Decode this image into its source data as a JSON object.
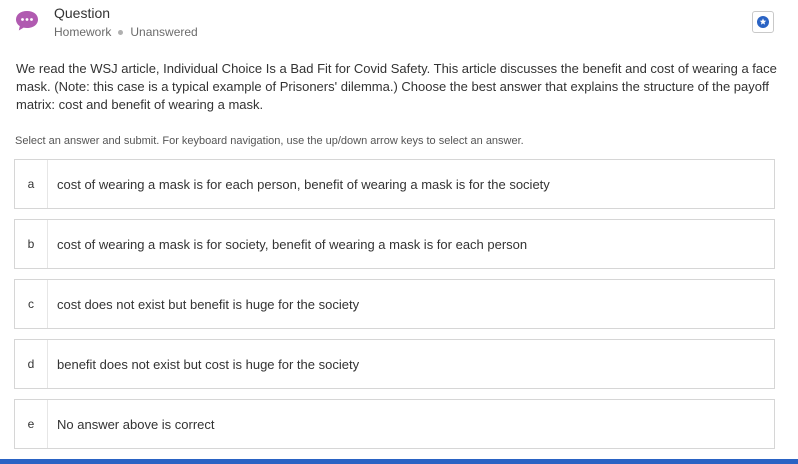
{
  "header": {
    "title": "Question",
    "category": "Homework",
    "status": "Unanswered",
    "icon": "chat-bubble-ellipsis-icon",
    "icon_color": "#b05ab0",
    "bookmark_icon": "star-badge-icon",
    "bookmark_color": "#2a63c4"
  },
  "question": {
    "text": "We read the WSJ article, Individual Choice Is a Bad Fit for Covid Safety. This article discusses the benefit and cost of wearing a face mask. (Note: this case is a typical example of Prisoners' dilemma.) Choose the best answer that explains the structure of the payoff matrix: cost and benefit of wearing a mask."
  },
  "instructions": "Select an answer and submit. For keyboard navigation, use the up/down arrow keys to select an answer.",
  "options": [
    {
      "letter": "a",
      "text": "cost of wearing a mask is for each person, benefit of wearing a mask is for the society"
    },
    {
      "letter": "b",
      "text": "cost of wearing a mask is for society, benefit of wearing a mask is for each person"
    },
    {
      "letter": "c",
      "text": "cost does not exist but benefit is huge for the society"
    },
    {
      "letter": "d",
      "text": "benefit does not exist but cost is huge for the society"
    },
    {
      "letter": "e",
      "text": "No answer above is correct"
    }
  ],
  "colors": {
    "accent": "#2a63c4",
    "border": "#d6d6d6"
  }
}
